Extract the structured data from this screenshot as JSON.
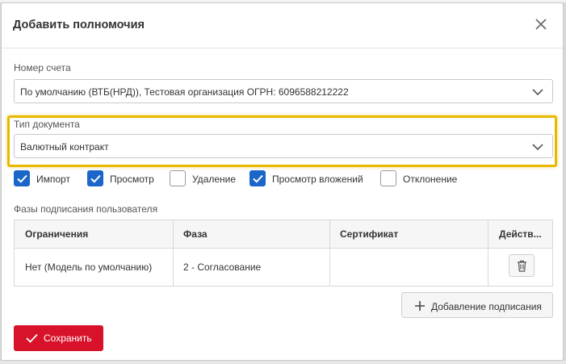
{
  "dialog": {
    "title": "Добавить полномочия",
    "close_icon": "close-icon"
  },
  "account": {
    "label": "Номер счета",
    "value": "По умолчанию (ВТБ(НРД)), Тестовая организация ОГРН: 6096588212222"
  },
  "doc_type": {
    "label": "Тип документа",
    "value": "Валютный контракт",
    "highlight_color": "#e8b800"
  },
  "permissions": [
    {
      "label": "Импорт",
      "checked": true
    },
    {
      "label": "Просмотр",
      "checked": true
    },
    {
      "label": "Удаление",
      "checked": false
    },
    {
      "label": "Просмотр вложений",
      "checked": true
    },
    {
      "label": "Отклонение",
      "checked": false
    }
  ],
  "phases": {
    "label": "Фазы подписания пользователя",
    "columns": [
      "Ограничения",
      "Фаза",
      "Сертификат",
      "Действ..."
    ],
    "rows": [
      {
        "restriction": "Нет (Модель по умолчанию)",
        "phase": "2 - Согласование",
        "certificate": ""
      }
    ]
  },
  "buttons": {
    "add_signing": "Добавление подписания",
    "save": "Сохранить"
  },
  "colors": {
    "primary": "#1b66c9",
    "danger": "#d8122a"
  }
}
